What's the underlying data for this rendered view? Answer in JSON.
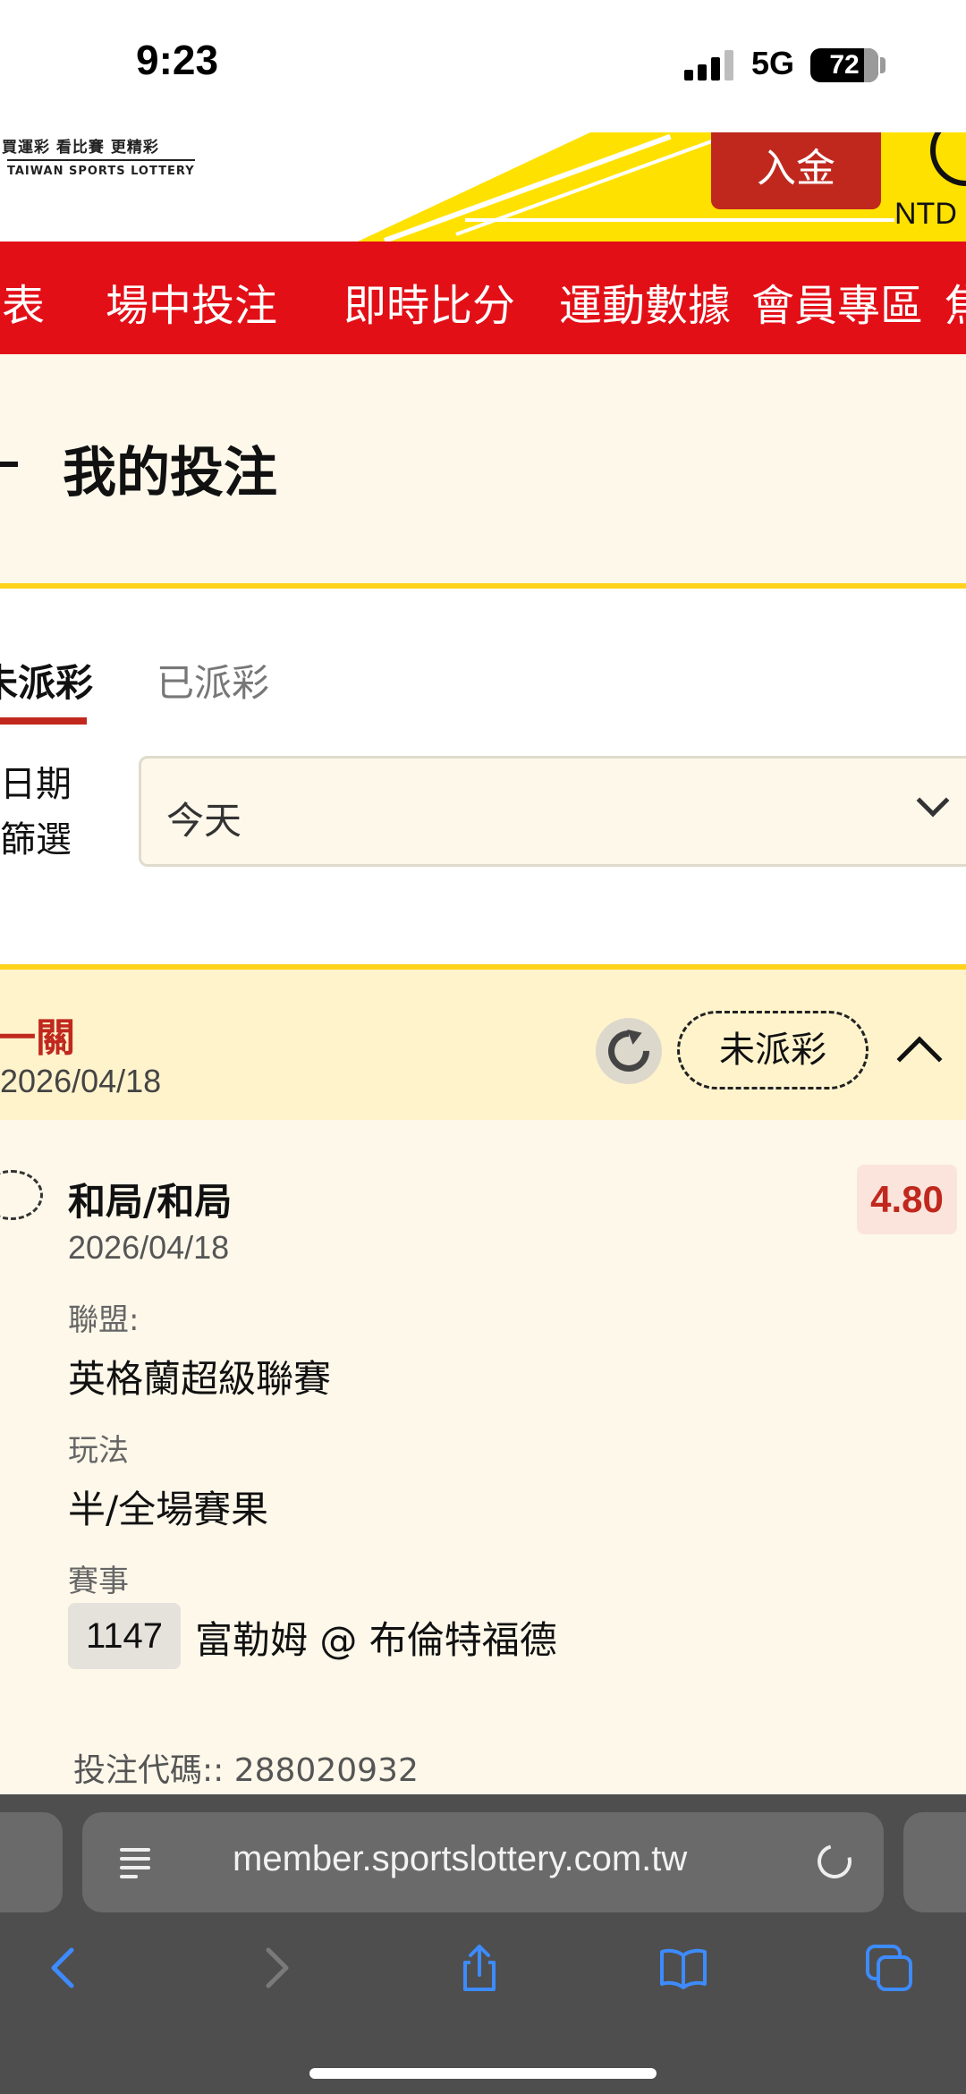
{
  "status_bar": {
    "time": "9:23",
    "network": "5G",
    "battery": "72"
  },
  "header": {
    "slogan": "買運彩 看比賽 更精彩",
    "brand_en": "TAIWAN SPORTS LOTTERY",
    "deposit_label": "入金",
    "currency": "NTD"
  },
  "nav": {
    "items": [
      "表",
      "場中投注",
      "即時比分",
      "運動數據",
      "會員專區",
      "焦"
    ]
  },
  "page": {
    "title": "我的投注"
  },
  "tabs": {
    "unsettled": "未派彩",
    "settled": "已派彩"
  },
  "filter": {
    "label_line1": "日期",
    "label_line2": "篩選",
    "value": "今天"
  },
  "bet": {
    "type": "一關",
    "date": "2026/04/18",
    "status": "未派彩",
    "pick": "和局/和局",
    "pick_date": "2026/04/18",
    "odds": "4.80",
    "league_label": "聯盟:",
    "league": "英格蘭超級聯賽",
    "play_label": "玩法",
    "play": "半/全場賽果",
    "match_label": "賽事",
    "match_no": "1147",
    "match": "富勒姆 @ 布倫特福德",
    "code_label": "投注代碼:",
    "code": ": 288020932"
  },
  "browser": {
    "url": "member.sportslottery.com.tw"
  }
}
